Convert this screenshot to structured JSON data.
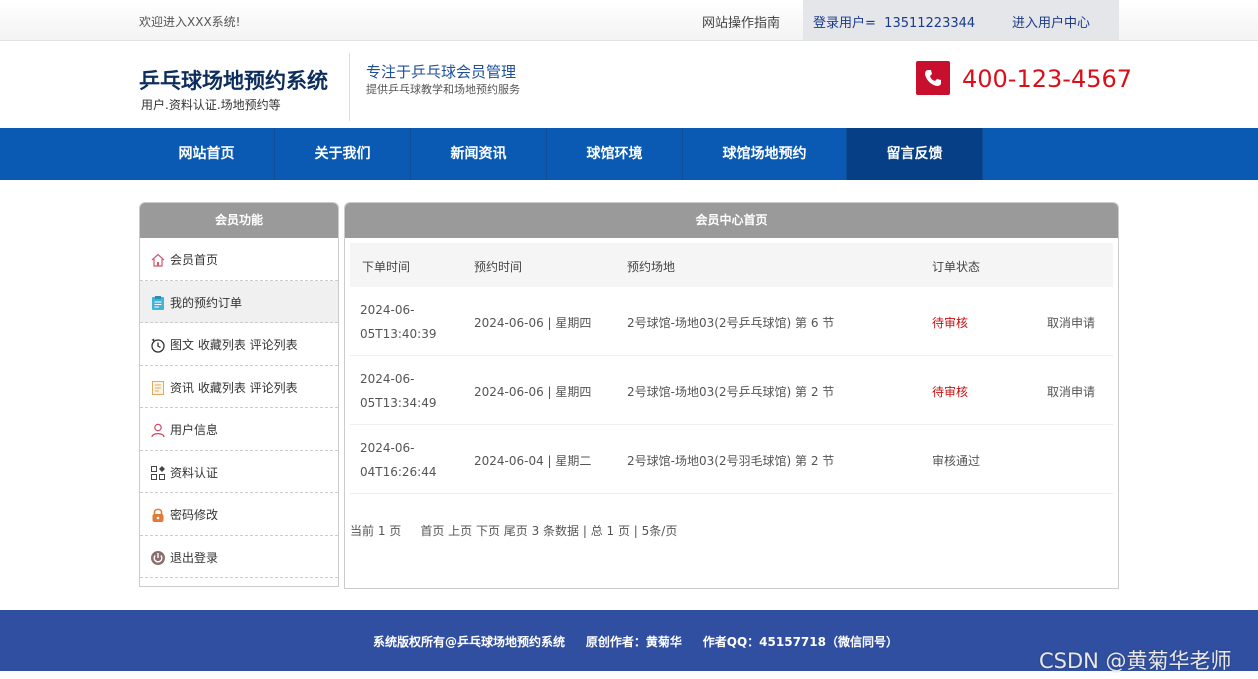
{
  "topbar": {
    "welcome": "欢迎进入XXX系统!",
    "guide": "网站操作指南",
    "login_label": "登录用户=",
    "login_user": "13511223344",
    "enter_center": "进入用户中心"
  },
  "header": {
    "logo": "乒乓球场地预约系统",
    "logo_sub": "用户.资料认证.场地预约等",
    "slogan": "专注于乒乓球会员管理",
    "slogan_sub": "提供乒乓球教学和场地预约服务",
    "phone": "400-123-4567"
  },
  "nav": {
    "items": [
      {
        "label": "网站首页"
      },
      {
        "label": "关于我们"
      },
      {
        "label": "新闻资讯"
      },
      {
        "label": "球馆环境"
      },
      {
        "label": "球馆场地预约"
      },
      {
        "label": "留言反馈"
      }
    ],
    "active": "留言反馈"
  },
  "sidebar": {
    "title": "会员功能",
    "items": [
      {
        "label": "会员首页",
        "icon": "home-icon"
      },
      {
        "label": "我的预约订单",
        "icon": "clipboard-icon"
      },
      {
        "label": "图文 收藏列表 评论列表",
        "icon": "refresh-clock-icon"
      },
      {
        "label": "资讯 收藏列表 评论列表",
        "icon": "document-icon"
      },
      {
        "label": "用户信息",
        "icon": "user-icon"
      },
      {
        "label": "资料认证",
        "icon": "grid-icon"
      },
      {
        "label": "密码修改",
        "icon": "lock-icon"
      },
      {
        "label": "退出登录",
        "icon": "power-icon"
      }
    ]
  },
  "main": {
    "title": "会员中心首页",
    "columns": [
      "下单时间",
      "预约时间",
      "预约场地",
      "订单状态"
    ],
    "rows": [
      {
        "order_time": "2024-06-05T13:40:39",
        "order_time_l1": "2024-06-",
        "order_time_l2": "05T13:40:39",
        "book_time": "2024-06-06 | 星期四",
        "venue": "2号球馆-场地03(2号乒乓球馆) 第 6 节",
        "status": "待审核",
        "action": "取消申请"
      },
      {
        "order_time": "2024-06-05T13:34:49",
        "order_time_l1": "2024-06-",
        "order_time_l2": "05T13:34:49",
        "book_time": "2024-06-06 | 星期四",
        "venue": "2号球馆-场地03(2号乒乓球馆) 第 2 节",
        "status": "待审核",
        "action": "取消申请"
      },
      {
        "order_time": "2024-06-04T16:26:44",
        "order_time_l1": "2024-06-",
        "order_time_l2": "04T16:26:44",
        "book_time": "2024-06-04 | 星期二",
        "venue": "2号球馆-场地03(2号羽毛球馆) 第 2 节",
        "status": "审核通过",
        "action": ""
      }
    ],
    "pager": "当前 1 页     首页 上页 下页 尾页 3 条数据 | 总 1 页 | 5条/页"
  },
  "footer": {
    "text": "系统版权所有@乒乓球场地预约系统     原创作者：黄菊华     作者QQ：45157718（微信同号）"
  },
  "watermark": "CSDN @黄菊华老师",
  "colors": {
    "nav_bg": "#0a5ab4",
    "nav_active": "#063f86",
    "footer_bg": "#304fa0",
    "phone_red": "#d9101a",
    "pending_red": "#cc1111"
  }
}
